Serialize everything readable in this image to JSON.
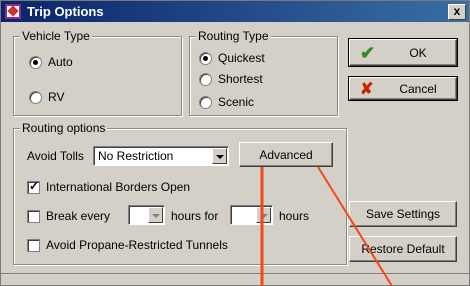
{
  "window": {
    "title": "Trip Options",
    "close_glyph": "x"
  },
  "vehicle_type": {
    "label": "Vehicle Type",
    "options": [
      {
        "label": "Auto",
        "selected": true
      },
      {
        "label": "RV",
        "selected": false
      }
    ]
  },
  "routing_type": {
    "label": "Routing Type",
    "options": [
      {
        "label": "Quickest",
        "selected": true
      },
      {
        "label": "Shortest",
        "selected": false
      },
      {
        "label": "Scenic",
        "selected": false
      }
    ]
  },
  "routing_options": {
    "label": "Routing options",
    "avoid_tolls_label": "Avoid Tolls",
    "avoid_tolls_value": "No Restriction",
    "advanced_label": "Advanced",
    "international_borders_label": "International Borders Open",
    "international_borders_checked": true,
    "break_every_label": "Break every",
    "break_every_checked": false,
    "hours_for_label": "hours for",
    "hours_label": "hours",
    "avoid_propane_label": "Avoid Propane-Restricted Tunnels",
    "avoid_propane_checked": false
  },
  "buttons": {
    "ok": "OK",
    "cancel": "Cancel",
    "save_settings": "Save Settings",
    "restore_default": "Restore Default"
  },
  "colors": {
    "title_bar": "#0a246a",
    "annotation_line": "#f04a1a",
    "ok_check": "#2e8b2e",
    "cancel_x": "#cc2200"
  }
}
